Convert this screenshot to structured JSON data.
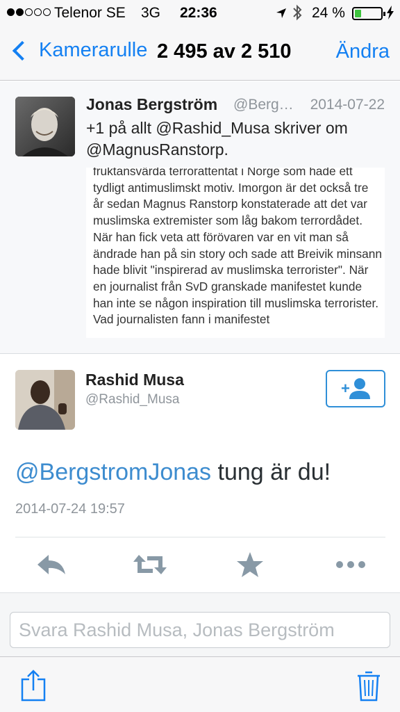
{
  "status_bar": {
    "carrier": "Telenor SE",
    "network": "3G",
    "time": "22:36",
    "battery": "24 %",
    "battery_level": 0.24,
    "signal_bars": 2
  },
  "nav": {
    "back_label": "Kamerarulle",
    "title": "2 495 av 2 510",
    "edit_label": "Ändra"
  },
  "quoted_tweet": {
    "name": "Jonas Bergström",
    "handle": "@Berg…",
    "date": "2014-07-22",
    "text": "+1 på allt @Rashid_Musa skriver om @MagnusRanstorp.",
    "image_text": "fruktansvärda terrorattentat i Norge som hade ett tydligt antimuslimskt motiv. Imorgon är det också tre år sedan Magnus Ranstorp konstaterade att det var muslimska extremister som låg bakom terrordådet. När han fick veta att förövaren var en vit man så ändrade han på sin story och sade att Breivik minsann hade blivit \"inspirerad av muslimska terrorister\". När en journalist från SvD granskade manifestet kunde han inte se någon inspiration till muslimska terrorister. Vad journalisten fann i manifestet"
  },
  "tweet": {
    "name": "Rashid Musa",
    "handle": "@Rashid_Musa",
    "mention": "@BergstromJonas",
    "text": " tung är du!",
    "timestamp": "2014-07-24 19:57"
  },
  "reply": {
    "placeholder": "Svara Rashid Musa, Jonas Bergström"
  },
  "colors": {
    "accent": "#1480f2",
    "link": "#3d8ccf",
    "icon_gray": "#8899a6",
    "battery_green": "#3ec43e"
  }
}
